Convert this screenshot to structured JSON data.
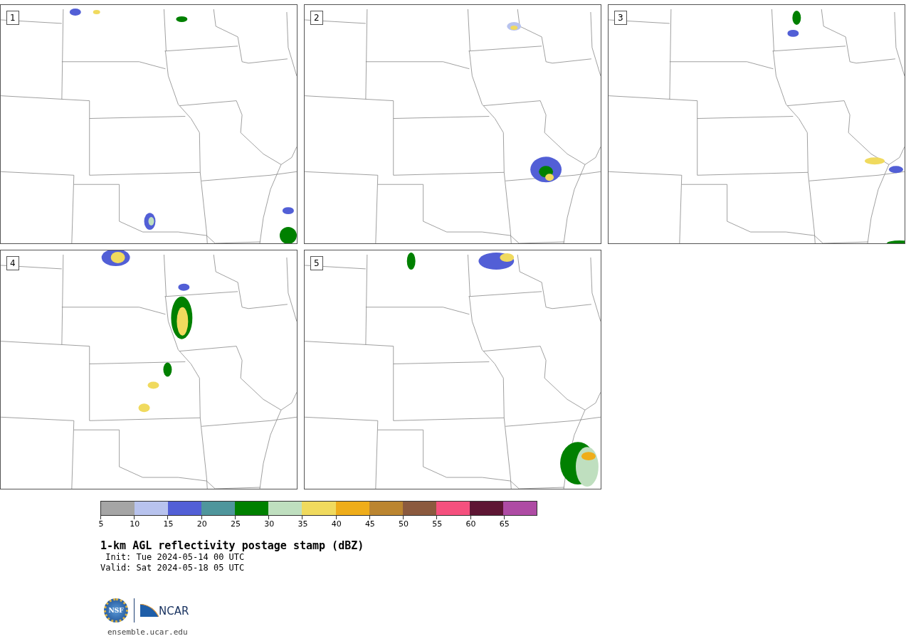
{
  "panels": [
    {
      "label": "1"
    },
    {
      "label": "2"
    },
    {
      "label": "3"
    },
    {
      "label": "4"
    },
    {
      "label": "5"
    }
  ],
  "colorbar": {
    "bins": [
      {
        "color": "#a5a5a5"
      },
      {
        "color": "#b8c3ee"
      },
      {
        "color": "#525fd6"
      },
      {
        "color": "#4f969c"
      },
      {
        "color": "#008000"
      },
      {
        "color": "#bfdfbf"
      },
      {
        "color": "#f0da5e"
      },
      {
        "color": "#efad1a"
      },
      {
        "color": "#bb8530"
      },
      {
        "color": "#8b5a3e"
      },
      {
        "color": "#f5507e"
      },
      {
        "color": "#5e1634"
      },
      {
        "color": "#ae4ba4"
      }
    ],
    "ticks": [
      "5",
      "10",
      "15",
      "20",
      "25",
      "30",
      "35",
      "40",
      "45",
      "50",
      "55",
      "60",
      "65"
    ]
  },
  "title": "1-km AGL reflectivity postage stamp (dBZ)",
  "init": " Init: Tue 2024-05-14 00 UTC",
  "valid": "Valid: Sat 2024-05-18 05 UTC",
  "logos": {
    "nsf_text": "NSF",
    "ncar_text": "NCAR"
  },
  "url": "ensemble.ucar.edu"
}
